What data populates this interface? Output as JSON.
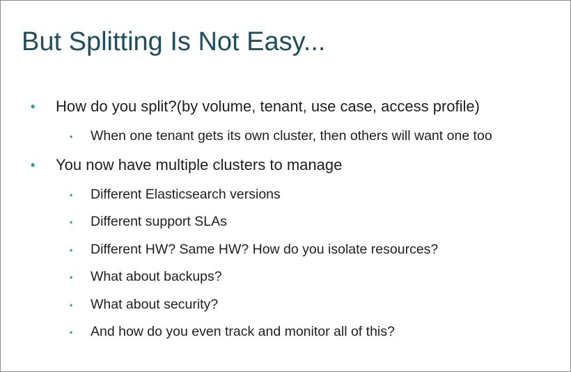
{
  "slide": {
    "title": "But Splitting Is Not Easy...",
    "accent_color": "#2f9c95",
    "title_color": "#1f4e5f",
    "bullet_glyph": "•",
    "bullets": [
      {
        "level": 1,
        "text": "How do you split?(by volume, tenant, use case, access profile)"
      },
      {
        "level": 2,
        "text": "When one tenant gets its own cluster, then others will want one too"
      },
      {
        "level": 1,
        "text": "You now have multiple clusters to manage"
      },
      {
        "level": 2,
        "text": "Different Elasticsearch versions"
      },
      {
        "level": 2,
        "text": "Different support SLAs"
      },
      {
        "level": 2,
        "text": "Different HW? Same HW? How do you isolate resources?"
      },
      {
        "level": 2,
        "text": "What about backups?"
      },
      {
        "level": 2,
        "text": "What about security?"
      },
      {
        "level": 2,
        "text": "And how do you even track and monitor all of this?"
      }
    ]
  }
}
